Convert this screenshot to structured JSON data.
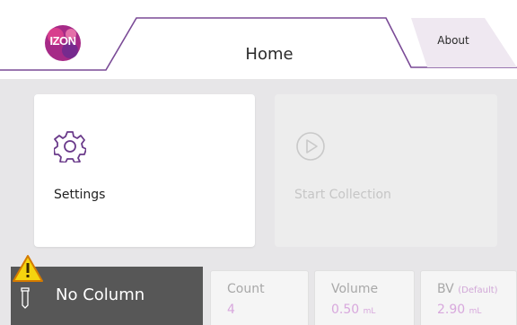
{
  "brand": {
    "logo_text": "IZON"
  },
  "tabs": {
    "home": "Home",
    "about": "About"
  },
  "cards": {
    "settings": {
      "label": "Settings",
      "icon": "gear-icon"
    },
    "start_collection": {
      "label": "Start Collection",
      "icon": "play-circle-icon"
    }
  },
  "status": {
    "text": "No Column",
    "warning_icon": "warning-icon",
    "column_icon": "column-icon"
  },
  "stats": {
    "count": {
      "label": "Count",
      "value": "4"
    },
    "volume": {
      "label": "Volume",
      "value": "0.50",
      "unit": "mL"
    },
    "bv": {
      "label": "BV",
      "qualifier": "(Default)",
      "value": "2.90",
      "unit": "mL"
    }
  },
  "colors": {
    "accent": "#7a4a96",
    "disabled_text": "#c6c6c6",
    "value_pink": "#d8a8dd",
    "status_bg": "#575757",
    "warning": "#f5d40f"
  }
}
